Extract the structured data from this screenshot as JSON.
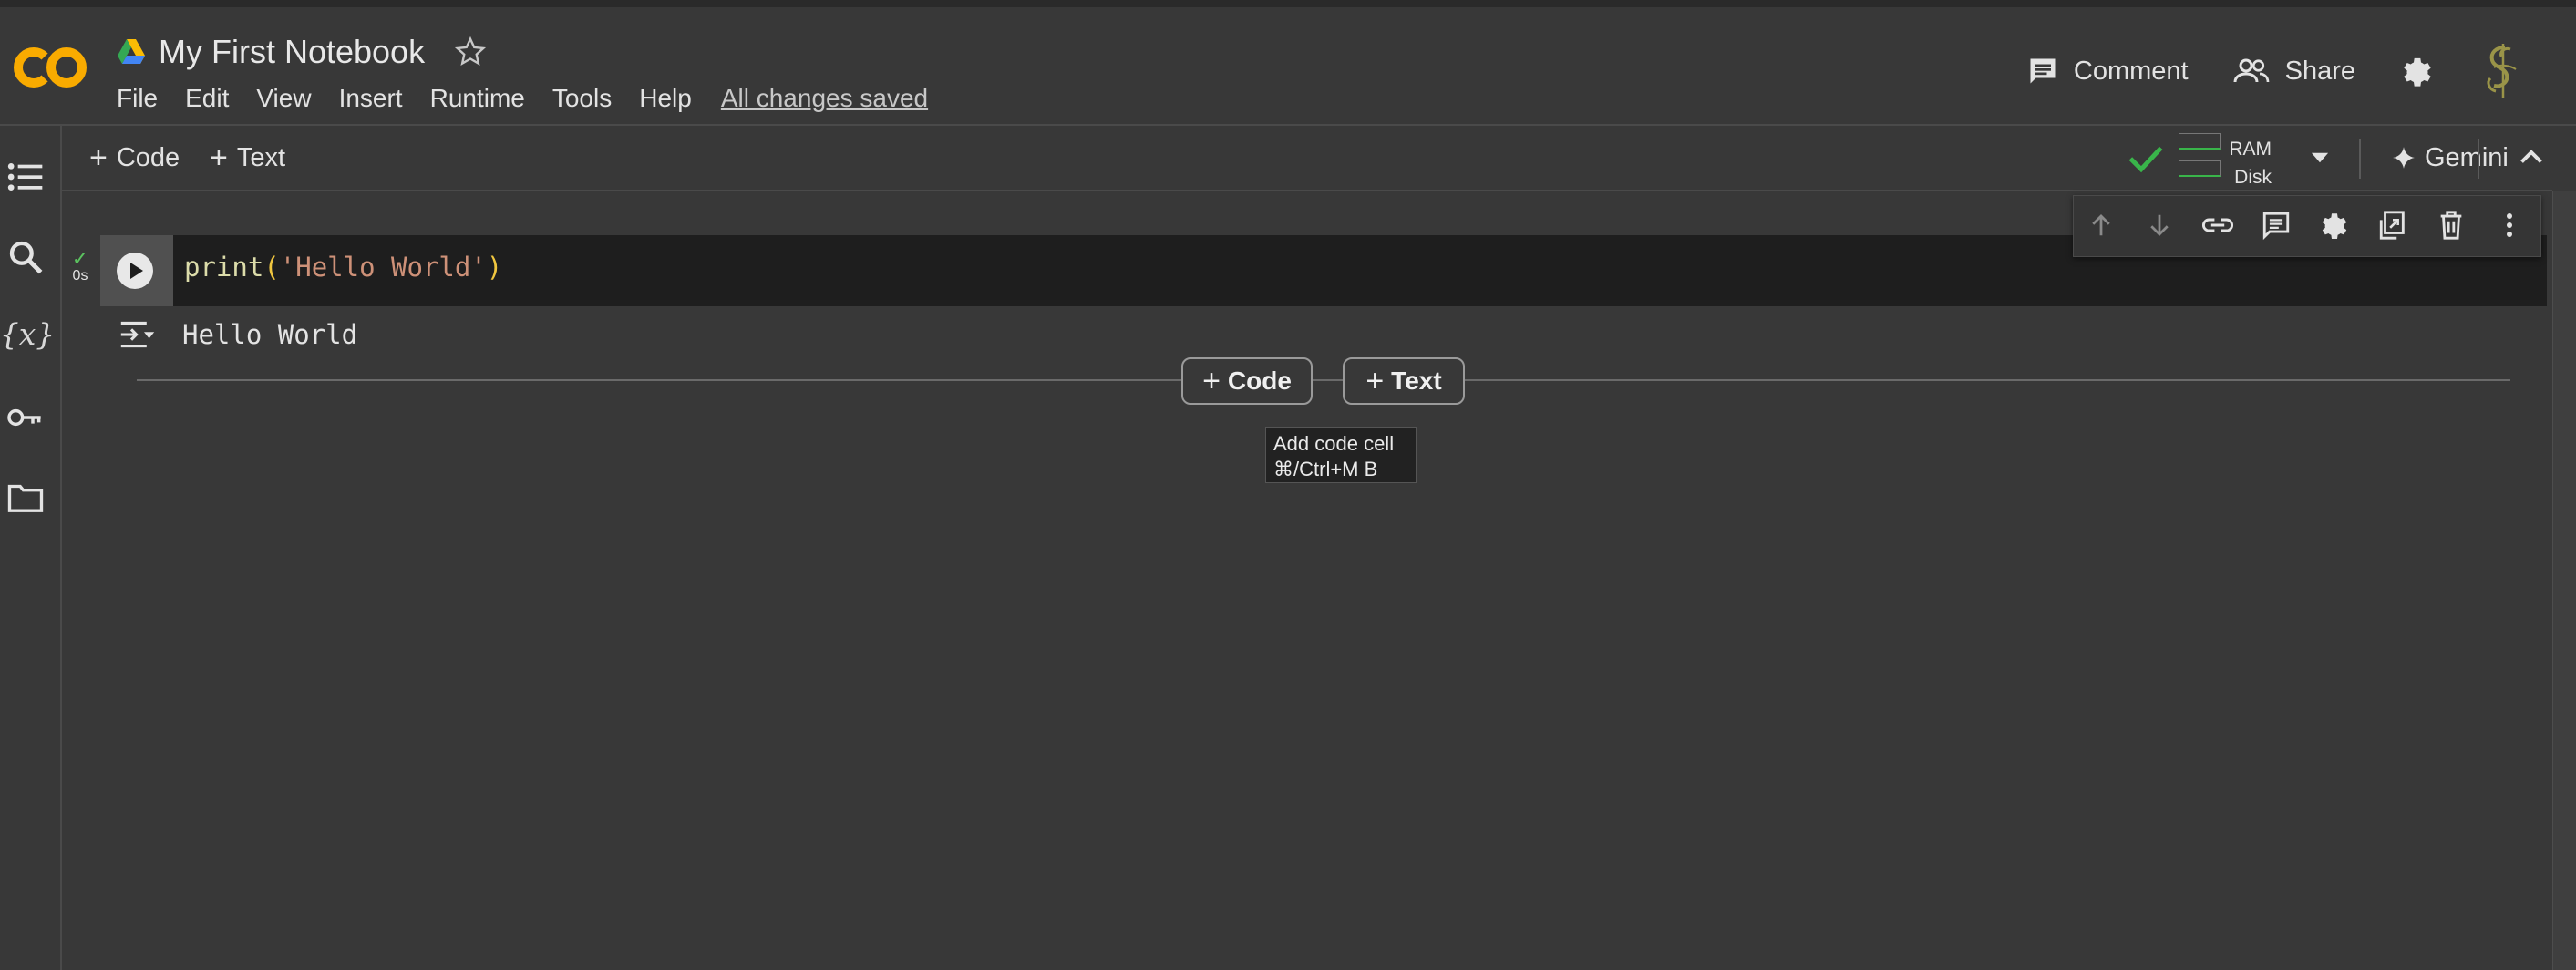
{
  "notebook": {
    "title": "My First Notebook"
  },
  "menu": {
    "items": [
      "File",
      "Edit",
      "View",
      "Insert",
      "Runtime",
      "Tools",
      "Help"
    ],
    "save_status": "All changes saved"
  },
  "header": {
    "comment_label": "Comment",
    "share_label": "Share"
  },
  "toolbar": {
    "add_code_label": "Code",
    "add_text_label": "Text",
    "ram_label": "RAM",
    "disk_label": "Disk",
    "gemini_label": "Gemini"
  },
  "cell": {
    "code_fn": "print",
    "code_open": "(",
    "code_string": "'Hello World'",
    "code_close": ")",
    "exec_time": "0s",
    "output": "Hello World"
  },
  "insert": {
    "code_label": "Code",
    "text_label": "Text",
    "tooltip_line1": "Add code cell",
    "tooltip_line2": "⌘/Ctrl+M B"
  },
  "colors": {
    "background": "#383838",
    "cell_background": "#1e1e1e",
    "accent_green": "#39b54a",
    "logo_orange": "#f9ab00"
  }
}
